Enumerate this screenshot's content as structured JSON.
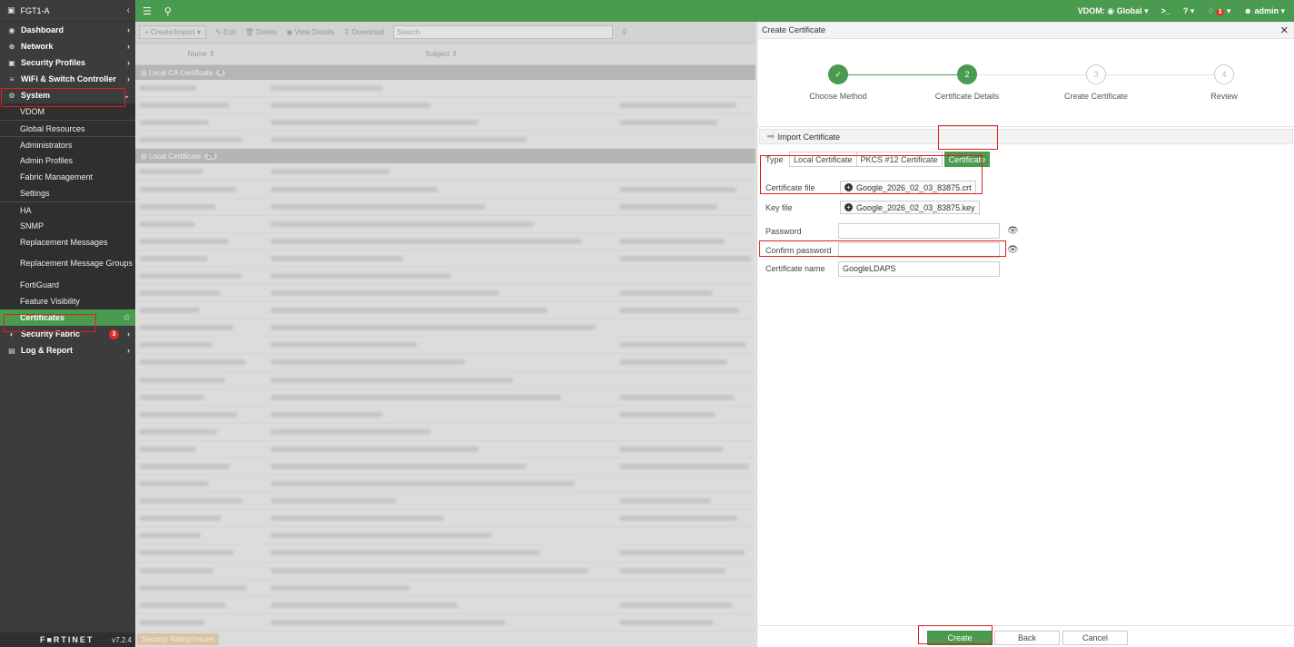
{
  "device": {
    "name": "FGT1-A",
    "version": "v7.2.4",
    "logo_text": "F■RTINET"
  },
  "sidebar": {
    "items": [
      {
        "label": "Dashboard",
        "icon": "dashboard-icon"
      },
      {
        "label": "Network",
        "icon": "network-icon"
      },
      {
        "label": "Security Profiles",
        "icon": "lock-icon"
      },
      {
        "label": "WiFi & Switch Controller",
        "icon": "wifi-icon"
      },
      {
        "label": "System",
        "icon": "gear-icon"
      }
    ],
    "system_sub": [
      "VDOM",
      "Global Resources",
      "Administrators",
      "Admin Profiles",
      "Fabric Management",
      "Settings",
      "HA",
      "SNMP",
      "Replacement Messages",
      "Replacement Message Groups",
      "FortiGuard",
      "Feature Visibility",
      "Certificates"
    ],
    "bottom_items": [
      {
        "label": "Security Fabric",
        "badge": "3"
      },
      {
        "label": "Log & Report"
      }
    ]
  },
  "topbar": {
    "vdom_label": "VDOM:",
    "vdom_value": "Global",
    "terminal": ">_",
    "help": "?",
    "alerts_badge": "3",
    "user": "admin"
  },
  "list": {
    "toolbar": {
      "create": "Create/Import",
      "edit": "Edit",
      "delete": "Delete",
      "view": "View Details",
      "download": "Download",
      "search_placeholder": "Search"
    },
    "columns": [
      "Name",
      "Subject"
    ],
    "groups": [
      {
        "label": "Local CA Certificate",
        "count": "4"
      },
      {
        "label": "Local Certificate",
        "count": "25"
      }
    ],
    "security_rating": "Security Rating Issues"
  },
  "panel": {
    "title": "Create Certificate",
    "steps": [
      {
        "num": "✓",
        "label": "Choose Method",
        "state": "done"
      },
      {
        "num": "2",
        "label": "Certificate Details",
        "state": "cur"
      },
      {
        "num": "3",
        "label": "Create Certificate",
        "state": "todo"
      },
      {
        "num": "4",
        "label": "Review",
        "state": "todo"
      }
    ],
    "section": "Import Certificate",
    "type_label": "Type",
    "type_options": [
      "Local Certificate",
      "PKCS #12 Certificate",
      "Certificate"
    ],
    "type_selected": "Certificate",
    "cert_file_label": "Certificate file",
    "cert_file_value": "Google_2026_02_03_83875.crt",
    "key_file_label": "Key file",
    "key_file_value": "Google_2026_02_03_83875.key",
    "password_label": "Password",
    "password_value": "",
    "confirm_label": "Confirm password",
    "confirm_value": "",
    "cert_name_label": "Certificate name",
    "cert_name_value": "GoogleLDAPS",
    "buttons": {
      "create": "Create",
      "back": "Back",
      "cancel": "Cancel"
    }
  },
  "colors": {
    "brand_green": "#4a9a4f",
    "sidebar_bg": "#3c3c3c",
    "highlight_red": "#e01e1e"
  }
}
